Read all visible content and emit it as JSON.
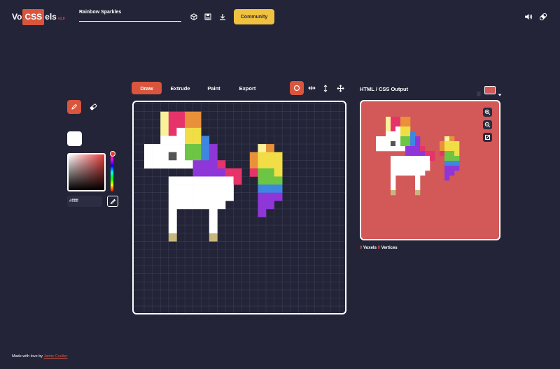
{
  "app": {
    "logo": {
      "part1": "Vo",
      "part2": "CSS",
      "part3": "els",
      "version": "v1.0"
    },
    "title": "Rainbow Sparkles"
  },
  "header": {
    "icons": [
      "cube-icon",
      "save-icon",
      "download-icon"
    ],
    "community_label": "Community",
    "right_icons": [
      "speaker-icon",
      "bandage-icon"
    ]
  },
  "tabs": [
    {
      "label": "Draw",
      "active": true
    },
    {
      "label": "Extrude",
      "active": false
    },
    {
      "label": "Paint",
      "active": false
    },
    {
      "label": "Export",
      "active": false
    }
  ],
  "tools": {
    "left": [
      "pencil-icon",
      "eraser-icon"
    ],
    "transform": [
      "circle-icon",
      "horizontal-arrows-icon",
      "vertical-arrows-icon",
      "move-icon"
    ]
  },
  "color": {
    "current": "#ffffff",
    "hex_value": "#ffffff",
    "picker_hue": "#e53b3b"
  },
  "output": {
    "title": "HTML / CSS Output",
    "bg_color": "#d25958",
    "voxels_count": "0",
    "voxels_label": "Voxels",
    "vertices_count": "0",
    "vertices_label": "Vertices"
  },
  "footer": {
    "text": "Made with love by",
    "author": "Jamie Coulter"
  },
  "colors": {
    "accent": "#d9553e",
    "background": "#232437",
    "community": "#f0c23f"
  },
  "pixel_art": {
    "palette": {
      "W": "#ffffff",
      "Y": "#f9f29a",
      "P": "#e6346b",
      "O": "#e8913a",
      "L": "#f1dd45",
      "G": "#6cc644",
      "B": "#3d87e0",
      "V": "#8f36d8",
      "K": "#555555",
      "T": "#c8b77d",
      "R": "#f0c23f"
    },
    "rows": [
      "..........................",
      "..........................",
      "..YPPOO...................",
      "..YPPOO...................",
      "..YPWLL...................",
      "..WWWLLB..................",
      "WWWWWGGBV.....YO..........",
      "WWWKWGGBV....OLLL.........",
      "WWWWWWVVVP...OLLL.........",
      "......VVVVPP.PGGL.........",
      "...WWWWWWWWP..GGG.........",
      "...WWWWWWWW...BBB.........",
      "...WWWWWWWW...VVV.........",
      "...WWWWWWW....VV..........",
      "...W....W.....V...........",
      "...W....W.................",
      "...W....W.................",
      "...T....T.................",
      "..........................",
      ".........................."
    ]
  }
}
